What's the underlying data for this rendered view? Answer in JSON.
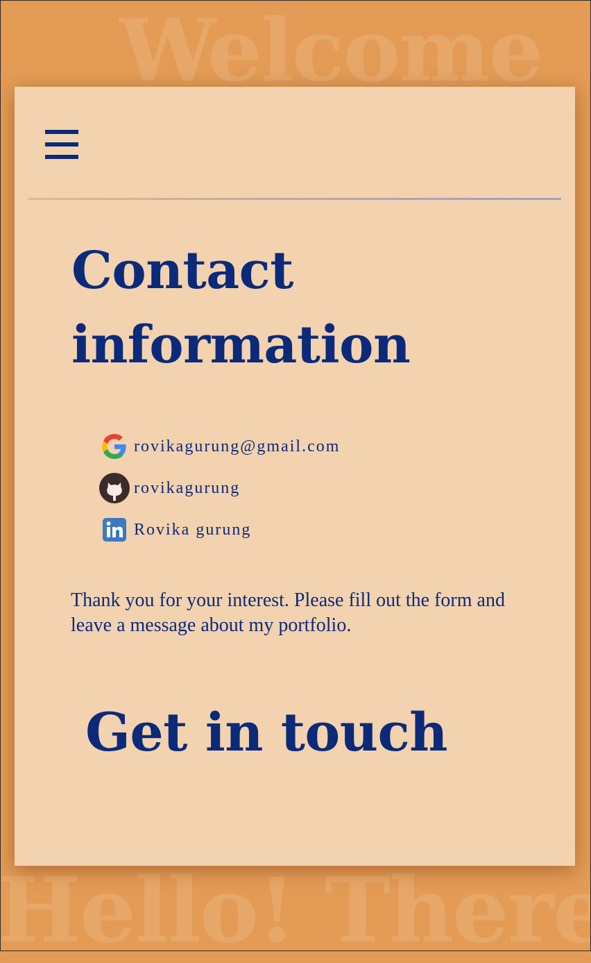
{
  "background": {
    "top_word": "Welcome",
    "bottom_word": "Hello! There."
  },
  "nav": {
    "menu_icon": "hamburger-menu-icon"
  },
  "page": {
    "title": "Contact information",
    "intro": "Thank you for your interest. Please fill out the form and leave a message about my portfolio.",
    "section_heading": "Get in touch"
  },
  "contacts": [
    {
      "icon": "google-icon",
      "text": "rovikagurung@gmail.com"
    },
    {
      "icon": "github-icon",
      "text": "rovikagurung"
    },
    {
      "icon": "linkedin-icon",
      "text": "Rovika gurung"
    }
  ],
  "colors": {
    "background": "#e39b55",
    "card": "#f3d2b0",
    "text": "#0b2a7a"
  }
}
